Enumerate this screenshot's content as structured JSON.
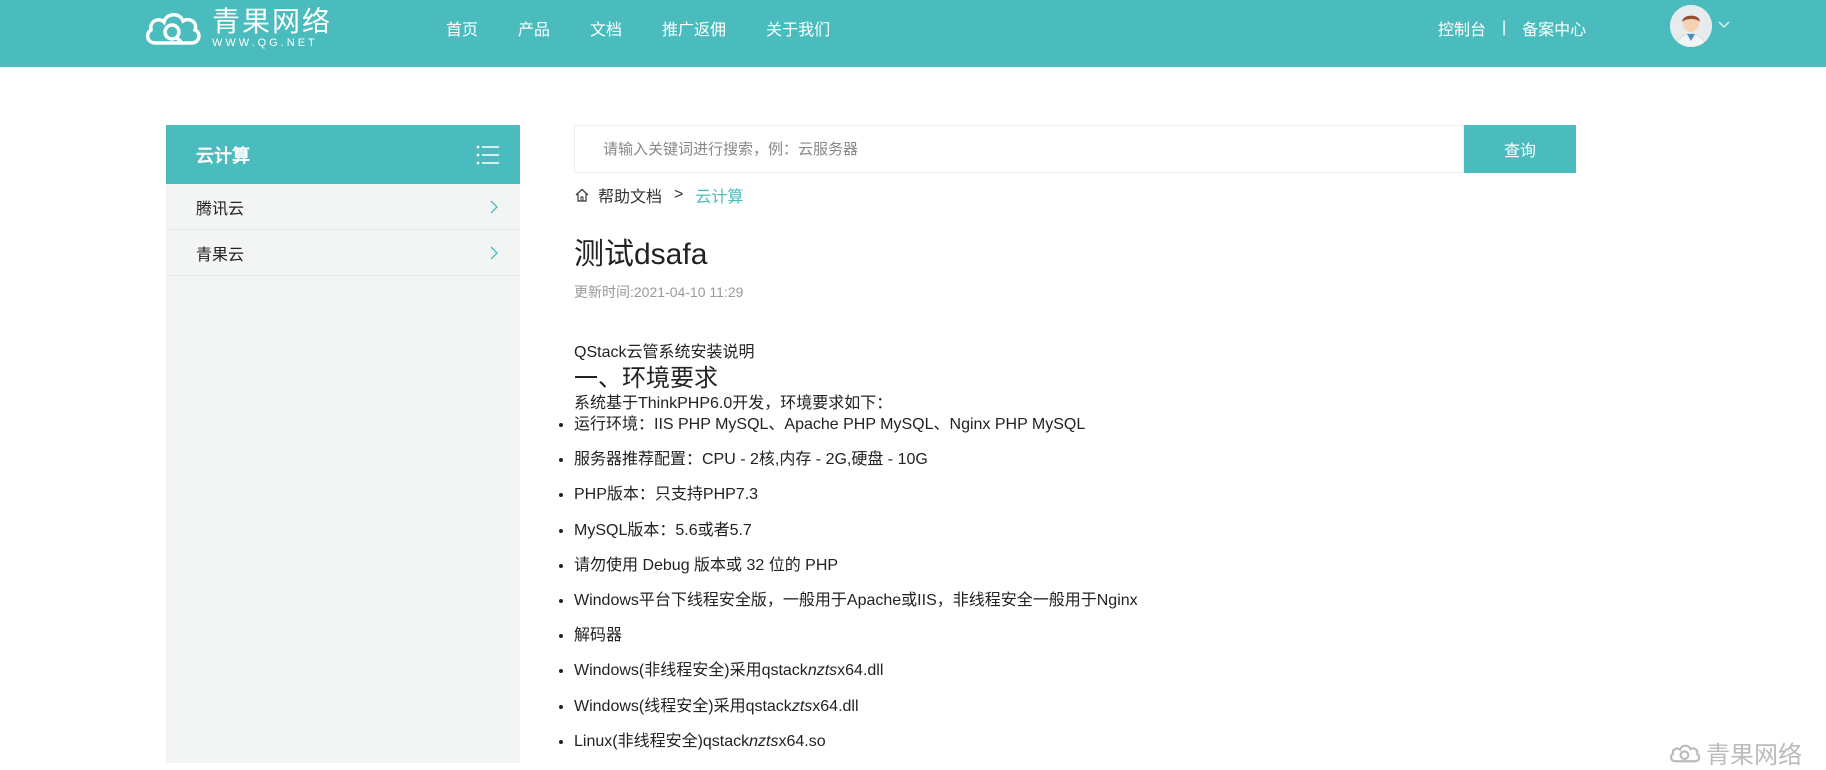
{
  "brand": {
    "name_cn": "青果网络",
    "name_en": "WWW.QG.NET",
    "color": "#4abcbe"
  },
  "nav": {
    "items": [
      "首页",
      "产品",
      "文档",
      "推广返佣",
      "关于我们"
    ]
  },
  "header_right": {
    "console": "控制台",
    "separator": "|",
    "filing": "备案中心"
  },
  "sidebar": {
    "title": "云计算",
    "items": [
      "腾讯云",
      "青果云"
    ]
  },
  "search": {
    "placeholder": "请输入关键词进行搜索，例：云服务器",
    "button": "查询"
  },
  "breadcrumb": {
    "home": "帮助文档",
    "separator": ">",
    "current": "云计算"
  },
  "article": {
    "title": "测试dsafa",
    "updated": "更新时间:2021-04-10 11:29",
    "intro": "QStack云管系统安装说明",
    "section1": "一、环境要求",
    "desc": "系统基于ThinkPHP6.0开发，环境要求如下：",
    "requirements": [
      "运行环境：IIS PHP MySQL、Apache PHP MySQL、Nginx PHP MySQL",
      "服务器推荐配置：CPU - 2核,内存 - 2G,硬盘 - 10G",
      "PHP版本：只支持PHP7.3",
      "MySQL版本：5.6或者5.7",
      "请勿使用 Debug 版本或 32 位的 PHP",
      "Windows平台下线程安全版，一般用于Apache或IIS，非线程安全一般用于Nginx",
      "解码器"
    ],
    "decoders": [
      {
        "prefix": "Windows(非线程安全)采用qstack",
        "italic": "nzts",
        "suffix": "x64.dll"
      },
      {
        "prefix": "Windows(线程安全)采用qstack",
        "italic": "zts",
        "suffix": "x64.dll"
      },
      {
        "prefix": "Linux(非线程安全)qstack",
        "italic": "nzts",
        "suffix": "x64.so"
      }
    ]
  },
  "watermark": "青果网络"
}
